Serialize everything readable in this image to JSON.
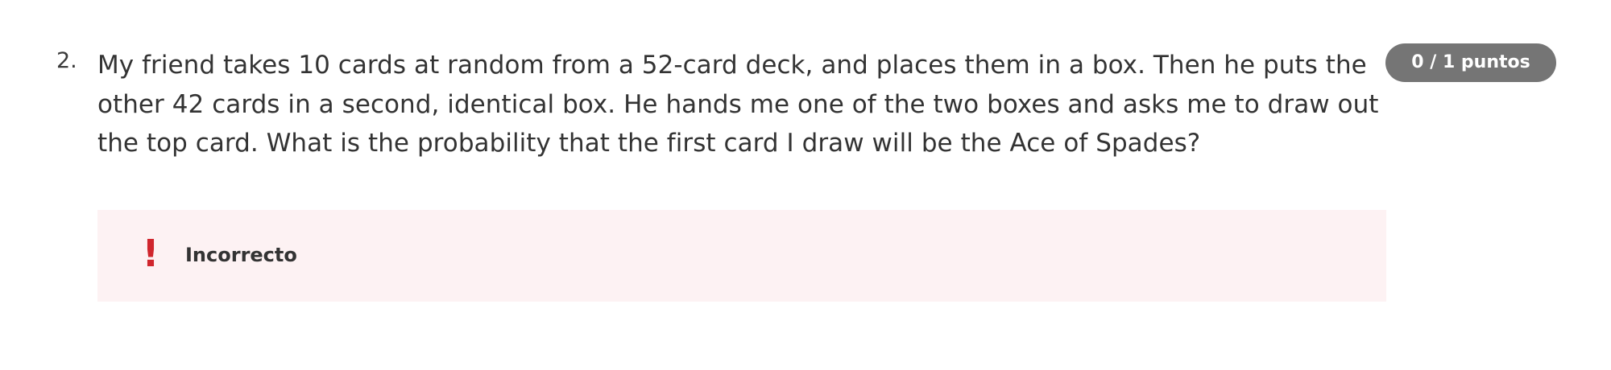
{
  "question": {
    "number": "2.",
    "text": "My friend takes 10 cards at random from a 52-card deck, and places them in a box. Then he puts the other 42 cards in a second, identical box. He hands me one of the two boxes and asks me to draw out the top card. What is the probability that the first card I draw will be the Ace of Spades?",
    "score": "0 / 1 puntos"
  },
  "feedback": {
    "icon": "exclamation-icon",
    "icon_glyph": "!",
    "label": "Incorrecto",
    "icon_color": "#d0262d",
    "background_color": "#fdf2f3"
  },
  "colors": {
    "badge_background": "#757575",
    "text": "#333333"
  }
}
